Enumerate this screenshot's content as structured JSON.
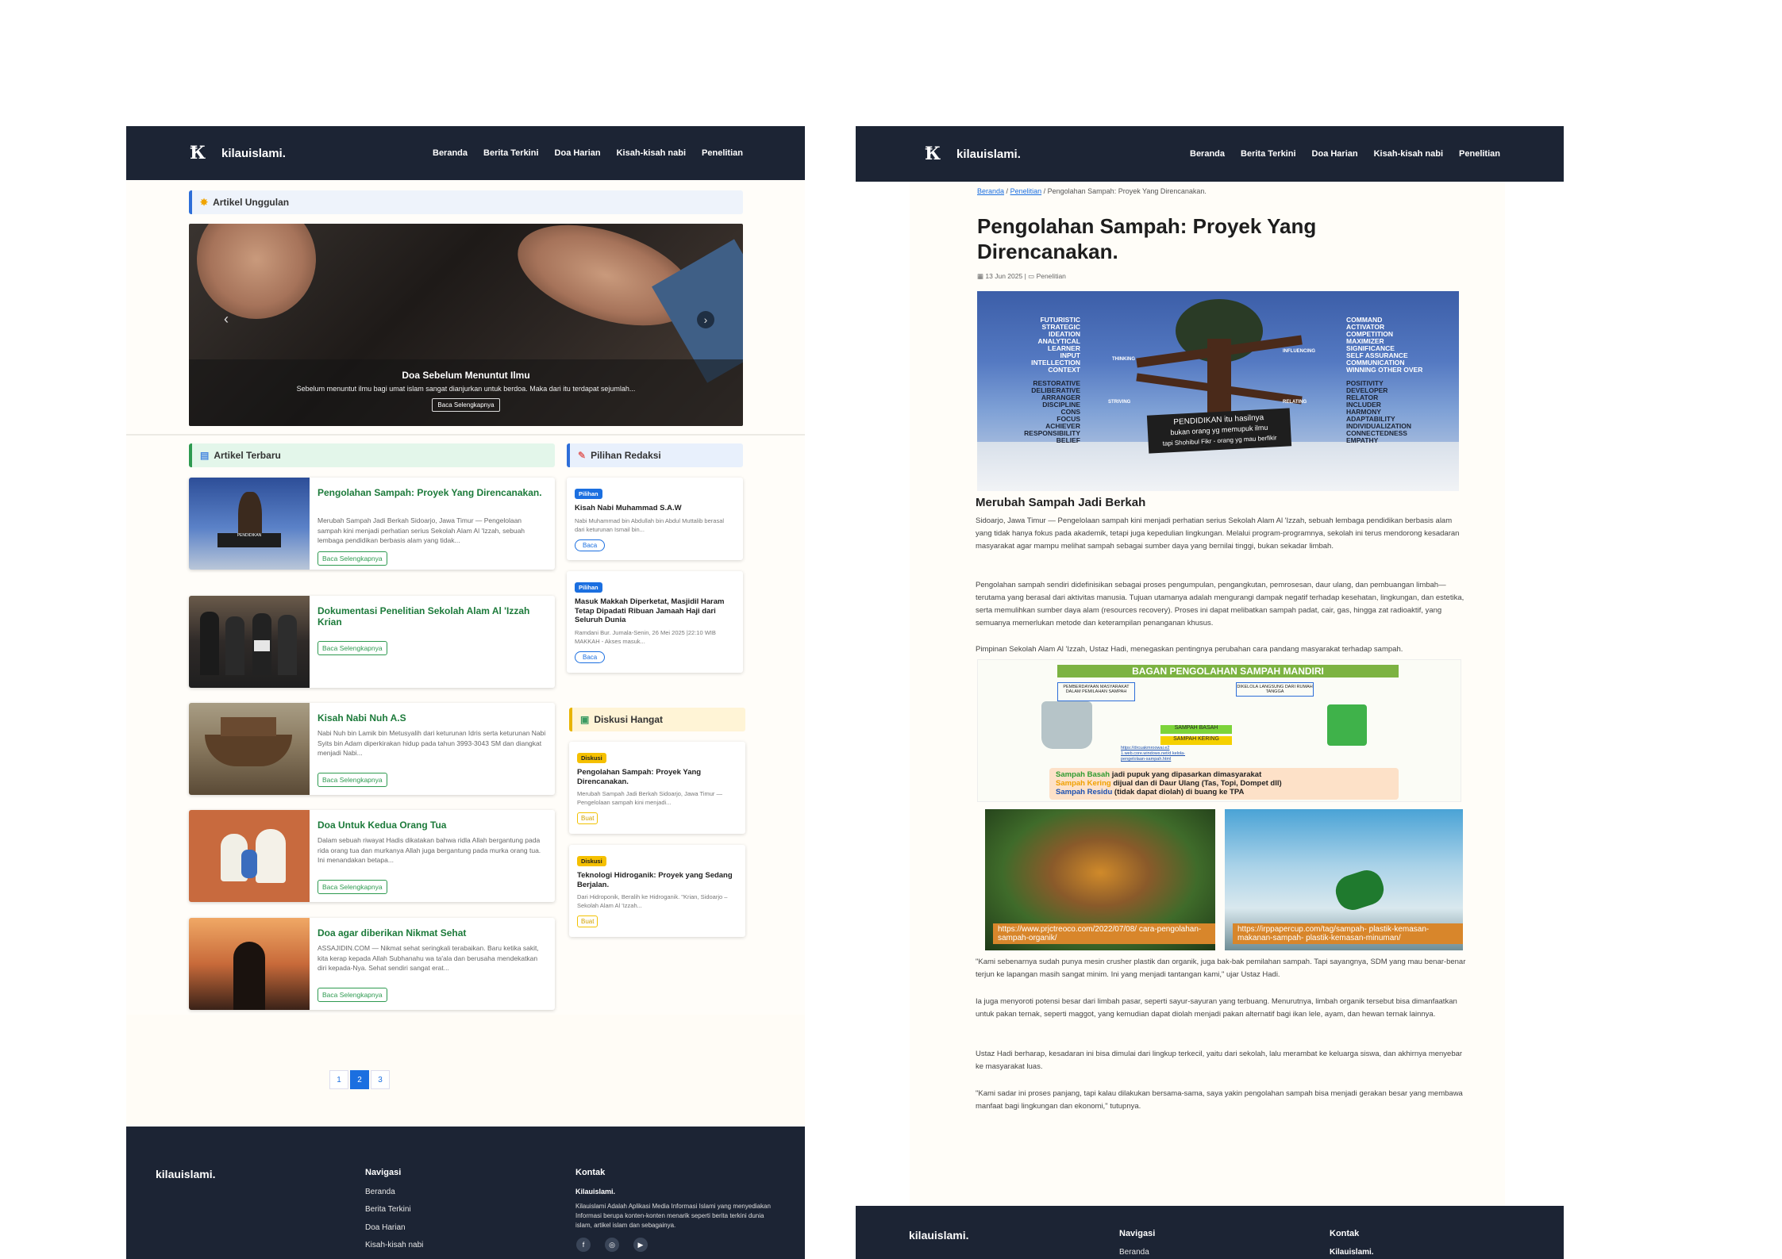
{
  "site": {
    "brand": "kilauislami.",
    "logo_glyph": "Ꝁ",
    "nav": [
      "Beranda",
      "Berita Terkini",
      "Doa Harian",
      "Kisah-kisah nabi",
      "Penelitian"
    ]
  },
  "home": {
    "featured_heading": "Artikel Unggulan",
    "hero": {
      "title": "Doa Sebelum Menuntut Ilmu",
      "desc": "Sebelum menuntut ilmu bagi umat islam sangat dianjurkan untuk berdoa. Maka dari itu terdapat sejumlah...",
      "button": "Baca Selengkapnya"
    },
    "latest_heading": "Artikel Terbaru",
    "articles": [
      {
        "title": "Pengolahan Sampah: Proyek Yang Direncanakan.",
        "excerpt": "Merubah Sampah Jadi Berkah Sidoarjo, Jawa Timur — Pengelolaan sampah kini menjadi perhatian serius Sekolah Alam Al 'Izzah, sebuah lembaga pendidikan berbasis alam yang tidak...",
        "button": "Baca Selengkapnya"
      },
      {
        "title": "Dokumentasi Penelitian Sekolah Alam Al 'Izzah Krian",
        "excerpt": "",
        "button": "Baca Selengkapnya"
      },
      {
        "title": "Kisah Nabi Nuh A.S",
        "excerpt": "Nabi Nuh bin Lamik bin Metusyalih dari keturunan Idris serta keturunan Nabi Syits bin Adam diperkirakan hidup pada tahun 3993-3043 SM dan diangkat menjadi Nabi...",
        "button": "Baca Selengkapnya"
      },
      {
        "title": "Doa Untuk Kedua Orang Tua",
        "excerpt": "Dalam sebuah riwayat Hadis dikatakan bahwa ridla Allah bergantung pada rida orang tua dan murkanya Allah juga bergantung pada murka orang tua. Ini menandakan betapa...",
        "button": "Baca Selengkapnya"
      },
      {
        "title": "Doa agar diberikan Nikmat Sehat",
        "excerpt": "ASSAJIDIN.COM — Nikmat sehat seringkali terabaikan. Baru ketika sakit, kita kerap kepada Allah Subhanahu wa ta'ala dan berusaha mendekatkan diri kepada-Nya. Sehat sendiri sangat erat...",
        "button": "Baca Selengkapnya"
      }
    ],
    "picks_heading": "Pilihan Redaksi",
    "picks": [
      {
        "badge": "Pilihan",
        "title": "Kisah Nabi Muhammad S.A.W",
        "excerpt": "Nabi Muhammad bin Abdullah bin Abdul Muttalib berasal dari keturunan Ismail bin...",
        "button": "Baca"
      },
      {
        "badge": "Pilihan",
        "title": "Masuk Makkah Diperketat, Masjidil Haram Tetap Dipadati Ribuan Jamaah Haji dari Seluruh Dunia",
        "excerpt": "Ramdani Bur. Jumala-Senin, 26 Mei 2025 |22:10 WIB MAKKAH - Akses masuk...",
        "button": "Baca"
      }
    ],
    "discuss_heading": "Diskusi Hangat",
    "discussions": [
      {
        "badge": "Diskusi",
        "title": "Pengolahan Sampah: Proyek Yang Direncanakan.",
        "excerpt": "Merubah Sampah Jadi Berkah Sidoarjo, Jawa Timur — Pengelolaan sampah kini menjadi...",
        "button": "Buat"
      },
      {
        "badge": "Diskusi",
        "title": "Teknologi Hidroganik: Proyek yang Sedang Berjalan.",
        "excerpt": "Dari Hidroponik, Beralih ke Hidroganik. \"Krian, Sidoarjo – Sekolah Alam Al 'Izzah...",
        "button": "Buat"
      }
    ],
    "pages": [
      "1",
      "2",
      "3"
    ]
  },
  "footer": {
    "brand": "kilauislami.",
    "nav_heading": "Navigasi",
    "nav": [
      "Beranda",
      "Berita Terkini",
      "Doa Harian",
      "Kisah-kisah nabi"
    ],
    "contact_heading": "Kontak",
    "contact_name": "Kilauislami.",
    "contact_desc": "Kilauislami Adalah Aplikasi Media Informasi Islami yang menyediakan Informasi berupa konten-konten menarik seperti berita terkini dunia islam, artikel islam dan sebagainya.",
    "right_nav": [
      "Beranda"
    ]
  },
  "article": {
    "crumbs": [
      "Beranda",
      "Penelitian",
      "Pengolahan Sampah: Proyek Yang Direncanakan."
    ],
    "title": "Pengolahan Sampah: Proyek Yang Direncanakan.",
    "date": "13 Jun 2025",
    "category": "Penelitian",
    "mural_left": [
      "FUTURISTIC",
      "STRATEGIC",
      "IDEATION",
      "ANALYTICAL",
      "LEARNER",
      "INPUT",
      "INTELLECTION",
      "CONTEXT"
    ],
    "mural_left2": [
      "RESTORATIVE",
      "DELIBERATIVE",
      "ARRANGER",
      "DISCIPLINE",
      "CONS",
      "FOCUS",
      "ACHIEVER",
      "RESPONSIBILITY",
      "BELIEF"
    ],
    "mural_right": [
      "COMMAND",
      "ACTIVATOR",
      "COMPETITION",
      "MAXIMIZER",
      "SIGNIFICANCE",
      "SELF ASSURANCE",
      "COMMUNICATION",
      "WINNING OTHER OVER"
    ],
    "mural_right2": [
      "POSITIVITY",
      "DEVELOPER",
      "RELATOR",
      "INCLUDER",
      "HARMONY",
      "ADAPTABILITY",
      "INDIVIDUALIZATION",
      "CONNECTEDNESS",
      "EMPATHY"
    ],
    "mural_branches": [
      "THINKING",
      "INFLUENCING",
      "STRIVING",
      "RELATING"
    ],
    "mural_board": [
      "PENDIDIKAN itu hasilnya",
      "bukan orang yg memupuk ilmu",
      "tapi Shohibul Fikr - orang yg mau berfikir"
    ],
    "subheading": "Merubah Sampah Jadi Berkah",
    "paragraphs": [
      "Sidoarjo, Jawa Timur — Pengelolaan sampah kini menjadi perhatian serius Sekolah Alam Al 'Izzah, sebuah lembaga pendidikan berbasis alam yang tidak hanya fokus pada akademik, tetapi juga kepedulian lingkungan. Melalui program-programnya, sekolah ini terus mendorong kesadaran masyarakat agar mampu melihat sampah sebagai sumber daya yang bernilai tinggi, bukan sekadar limbah.",
      "Pengolahan sampah sendiri didefinisikan sebagai proses pengumpulan, pengangkutan, pemrosesan, daur ulang, dan pembuangan limbah—terutama yang berasal dari aktivitas manusia. Tujuan utamanya adalah mengurangi dampak negatif terhadap kesehatan, lingkungan, dan estetika, serta memulihkan sumber daya alam (resources recovery). Proses ini dapat melibatkan sampah padat, cair, gas, hingga zat radioaktif, yang semuanya memerlukan metode dan keterampilan penanganan khusus.",
      "Pimpinan Sekolah Alam Al 'Izzah, Ustaz Hadi, menegaskan pentingnya perubahan cara pandang masyarakat terhadap sampah."
    ],
    "diagram": {
      "title": "BAGAN PENGOLAHAN SAMPAH MANDIRI",
      "box1": "PEMBERDAYAAN MASYARAKAT DALAM PEMILAHAN SAMPAH",
      "box2": "DIKELOLA LANGSUNG DARI RUMAH TANGGA",
      "wet": "SAMPAH BASAH",
      "dry": "SAMPAH KERING",
      "link": "https://drcuakmroowai.e2 1.web.core.windows.net/d kelola-pengelolaan-sampah.html",
      "l1a": "Sampah Basah",
      "l1b": "jadi pupuk yang dipasarkan dimasyarakat",
      "l2a": "Sampah Kering",
      "l2b": "dijual dan di Daur Ulang (Tas, Topi, Dompet dll)",
      "l3a": "Sampah Residu",
      "l3b": "(tidak dapat diolah) di buang ke TPA"
    },
    "photo1_url": "https://www.prjctreoco.com/2022/07/08/ cara-pengolahan-sampah-organik/",
    "photo2_url": "https://irppapercup.com/tag/sampah- plastik-kemasan-makanan-sampah- plastik-kemasan-minuman/",
    "paragraphs2": [
      "\"Kami sebenarnya sudah punya mesin crusher plastik dan organik, juga bak-bak pemilahan sampah. Tapi sayangnya, SDM yang mau benar-benar terjun ke lapangan masih sangat minim. Ini yang menjadi tantangan kami,\" ujar Ustaz Hadi.",
      "Ia juga menyoroti potensi besar dari limbah pasar, seperti sayur-sayuran yang terbuang. Menurutnya, limbah organik tersebut bisa dimanfaatkan untuk pakan ternak, seperti maggot, yang kemudian dapat diolah menjadi pakan alternatif bagi ikan lele, ayam, dan hewan ternak lainnya.",
      "Ustaz Hadi berharap, kesadaran ini bisa dimulai dari lingkup terkecil, yaitu dari sekolah, lalu merambat ke keluarga siswa, dan akhirnya menyebar ke masyarakat luas.",
      "\"Kami sadar ini proses panjang, tapi kalau dilakukan bersama-sama, saya yakin pengolahan sampah bisa menjadi gerakan besar yang membawa manfaat bagi lingkungan dan ekonomi,\" tutupnya."
    ]
  }
}
